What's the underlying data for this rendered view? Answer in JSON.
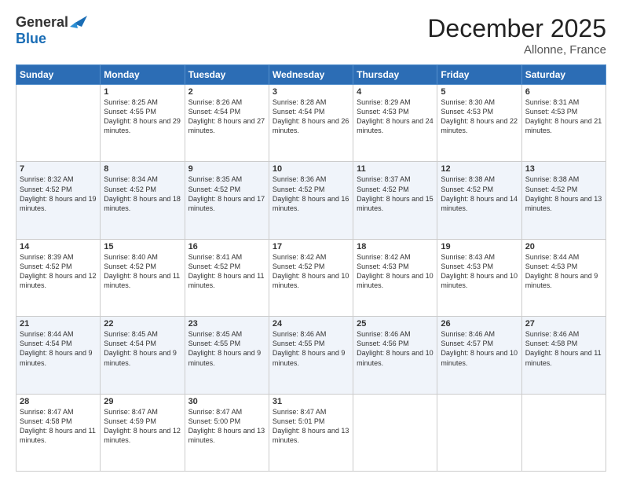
{
  "header": {
    "logo_general": "General",
    "logo_blue": "Blue",
    "month_title": "December 2025",
    "location": "Allonne, France"
  },
  "days_of_week": [
    "Sunday",
    "Monday",
    "Tuesday",
    "Wednesday",
    "Thursday",
    "Friday",
    "Saturday"
  ],
  "weeks": [
    [
      {
        "day": "",
        "sunrise": "",
        "sunset": "",
        "daylight": ""
      },
      {
        "day": "1",
        "sunrise": "Sunrise: 8:25 AM",
        "sunset": "Sunset: 4:55 PM",
        "daylight": "Daylight: 8 hours and 29 minutes."
      },
      {
        "day": "2",
        "sunrise": "Sunrise: 8:26 AM",
        "sunset": "Sunset: 4:54 PM",
        "daylight": "Daylight: 8 hours and 27 minutes."
      },
      {
        "day": "3",
        "sunrise": "Sunrise: 8:28 AM",
        "sunset": "Sunset: 4:54 PM",
        "daylight": "Daylight: 8 hours and 26 minutes."
      },
      {
        "day": "4",
        "sunrise": "Sunrise: 8:29 AM",
        "sunset": "Sunset: 4:53 PM",
        "daylight": "Daylight: 8 hours and 24 minutes."
      },
      {
        "day": "5",
        "sunrise": "Sunrise: 8:30 AM",
        "sunset": "Sunset: 4:53 PM",
        "daylight": "Daylight: 8 hours and 22 minutes."
      },
      {
        "day": "6",
        "sunrise": "Sunrise: 8:31 AM",
        "sunset": "Sunset: 4:53 PM",
        "daylight": "Daylight: 8 hours and 21 minutes."
      }
    ],
    [
      {
        "day": "7",
        "sunrise": "Sunrise: 8:32 AM",
        "sunset": "Sunset: 4:52 PM",
        "daylight": "Daylight: 8 hours and 19 minutes."
      },
      {
        "day": "8",
        "sunrise": "Sunrise: 8:34 AM",
        "sunset": "Sunset: 4:52 PM",
        "daylight": "Daylight: 8 hours and 18 minutes."
      },
      {
        "day": "9",
        "sunrise": "Sunrise: 8:35 AM",
        "sunset": "Sunset: 4:52 PM",
        "daylight": "Daylight: 8 hours and 17 minutes."
      },
      {
        "day": "10",
        "sunrise": "Sunrise: 8:36 AM",
        "sunset": "Sunset: 4:52 PM",
        "daylight": "Daylight: 8 hours and 16 minutes."
      },
      {
        "day": "11",
        "sunrise": "Sunrise: 8:37 AM",
        "sunset": "Sunset: 4:52 PM",
        "daylight": "Daylight: 8 hours and 15 minutes."
      },
      {
        "day": "12",
        "sunrise": "Sunrise: 8:38 AM",
        "sunset": "Sunset: 4:52 PM",
        "daylight": "Daylight: 8 hours and 14 minutes."
      },
      {
        "day": "13",
        "sunrise": "Sunrise: 8:38 AM",
        "sunset": "Sunset: 4:52 PM",
        "daylight": "Daylight: 8 hours and 13 minutes."
      }
    ],
    [
      {
        "day": "14",
        "sunrise": "Sunrise: 8:39 AM",
        "sunset": "Sunset: 4:52 PM",
        "daylight": "Daylight: 8 hours and 12 minutes."
      },
      {
        "day": "15",
        "sunrise": "Sunrise: 8:40 AM",
        "sunset": "Sunset: 4:52 PM",
        "daylight": "Daylight: 8 hours and 11 minutes."
      },
      {
        "day": "16",
        "sunrise": "Sunrise: 8:41 AM",
        "sunset": "Sunset: 4:52 PM",
        "daylight": "Daylight: 8 hours and 11 minutes."
      },
      {
        "day": "17",
        "sunrise": "Sunrise: 8:42 AM",
        "sunset": "Sunset: 4:52 PM",
        "daylight": "Daylight: 8 hours and 10 minutes."
      },
      {
        "day": "18",
        "sunrise": "Sunrise: 8:42 AM",
        "sunset": "Sunset: 4:53 PM",
        "daylight": "Daylight: 8 hours and 10 minutes."
      },
      {
        "day": "19",
        "sunrise": "Sunrise: 8:43 AM",
        "sunset": "Sunset: 4:53 PM",
        "daylight": "Daylight: 8 hours and 10 minutes."
      },
      {
        "day": "20",
        "sunrise": "Sunrise: 8:44 AM",
        "sunset": "Sunset: 4:53 PM",
        "daylight": "Daylight: 8 hours and 9 minutes."
      }
    ],
    [
      {
        "day": "21",
        "sunrise": "Sunrise: 8:44 AM",
        "sunset": "Sunset: 4:54 PM",
        "daylight": "Daylight: 8 hours and 9 minutes."
      },
      {
        "day": "22",
        "sunrise": "Sunrise: 8:45 AM",
        "sunset": "Sunset: 4:54 PM",
        "daylight": "Daylight: 8 hours and 9 minutes."
      },
      {
        "day": "23",
        "sunrise": "Sunrise: 8:45 AM",
        "sunset": "Sunset: 4:55 PM",
        "daylight": "Daylight: 8 hours and 9 minutes."
      },
      {
        "day": "24",
        "sunrise": "Sunrise: 8:46 AM",
        "sunset": "Sunset: 4:55 PM",
        "daylight": "Daylight: 8 hours and 9 minutes."
      },
      {
        "day": "25",
        "sunrise": "Sunrise: 8:46 AM",
        "sunset": "Sunset: 4:56 PM",
        "daylight": "Daylight: 8 hours and 10 minutes."
      },
      {
        "day": "26",
        "sunrise": "Sunrise: 8:46 AM",
        "sunset": "Sunset: 4:57 PM",
        "daylight": "Daylight: 8 hours and 10 minutes."
      },
      {
        "day": "27",
        "sunrise": "Sunrise: 8:46 AM",
        "sunset": "Sunset: 4:58 PM",
        "daylight": "Daylight: 8 hours and 11 minutes."
      }
    ],
    [
      {
        "day": "28",
        "sunrise": "Sunrise: 8:47 AM",
        "sunset": "Sunset: 4:58 PM",
        "daylight": "Daylight: 8 hours and 11 minutes."
      },
      {
        "day": "29",
        "sunrise": "Sunrise: 8:47 AM",
        "sunset": "Sunset: 4:59 PM",
        "daylight": "Daylight: 8 hours and 12 minutes."
      },
      {
        "day": "30",
        "sunrise": "Sunrise: 8:47 AM",
        "sunset": "Sunset: 5:00 PM",
        "daylight": "Daylight: 8 hours and 13 minutes."
      },
      {
        "day": "31",
        "sunrise": "Sunrise: 8:47 AM",
        "sunset": "Sunset: 5:01 PM",
        "daylight": "Daylight: 8 hours and 13 minutes."
      },
      {
        "day": "",
        "sunrise": "",
        "sunset": "",
        "daylight": ""
      },
      {
        "day": "",
        "sunrise": "",
        "sunset": "",
        "daylight": ""
      },
      {
        "day": "",
        "sunrise": "",
        "sunset": "",
        "daylight": ""
      }
    ]
  ]
}
